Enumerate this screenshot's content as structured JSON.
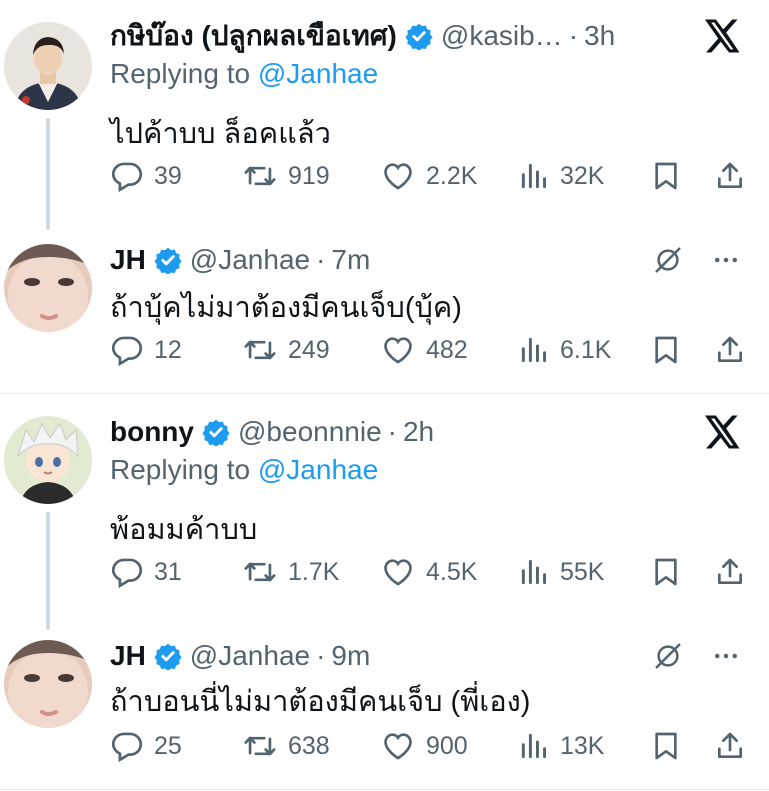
{
  "colors": {
    "text": "#0f1419",
    "muted": "#536471",
    "accent": "#1d9bf0",
    "line": "#cfd9de"
  },
  "icons": {
    "reply": "reply-icon",
    "repost": "repost-icon",
    "like": "heart-icon",
    "views": "views-icon",
    "bookmark": "bookmark-icon",
    "share": "share-icon",
    "platform": "x-logo-icon",
    "grok": "grok-icon",
    "more": "more-icon",
    "verified": "verified-badge-icon"
  },
  "threads": [
    {
      "original": {
        "name": "กษิบ๊อง (ปลูกผลเขือเทศ)",
        "handle": "@kasib…",
        "time": "3h",
        "replying_prefix": "Replying to",
        "replying_to": "@Janhae",
        "text": "ไปค้าบบ ล็อคแล้ว",
        "stats": {
          "replies": "39",
          "reposts": "919",
          "likes": "2.2K",
          "views": "32K"
        }
      },
      "reply": {
        "name": "JH",
        "handle": "@Janhae",
        "time": "7m",
        "text": "ถ้าบุ้คไม่มาต้องมีคนเจ็บ(บุ้ค)",
        "stats": {
          "replies": "12",
          "reposts": "249",
          "likes": "482",
          "views": "6.1K"
        }
      }
    },
    {
      "original": {
        "name": "bonny",
        "handle": "@beonnnie",
        "time": "2h",
        "replying_prefix": "Replying to",
        "replying_to": "@Janhae",
        "text": "พ้อมมค้าบบ",
        "stats": {
          "replies": "31",
          "reposts": "1.7K",
          "likes": "4.5K",
          "views": "55K"
        }
      },
      "reply": {
        "name": "JH",
        "handle": "@Janhae",
        "time": "9m",
        "text": "ถ้าบอนนี่ไม่มาต้องมีคนเจ็บ (พี่เอง)",
        "stats": {
          "replies": "25",
          "reposts": "638",
          "likes": "900",
          "views": "13K"
        }
      }
    }
  ]
}
